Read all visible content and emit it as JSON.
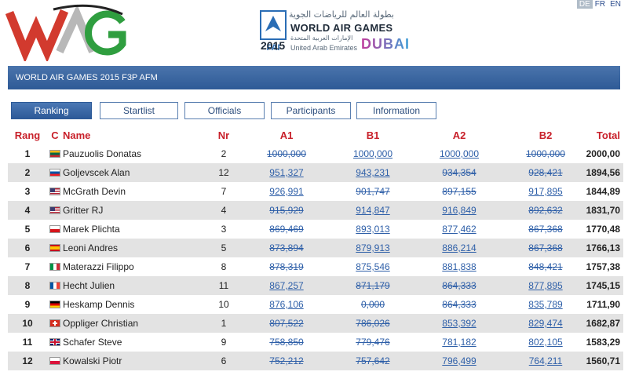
{
  "header": {
    "logo_text": "WAG",
    "fai_text": "FAI",
    "arabic_title": "بطولة العالم للرياضات الجوية",
    "title": "WORLD AIR GAMES",
    "year": "2015",
    "uae_arabic": "الإمارات العربية المتحدة",
    "uae": "United Arab Emirates",
    "dubai": "DUBAI"
  },
  "languages": [
    {
      "label": "DE",
      "active": true
    },
    {
      "label": "FR",
      "active": false
    },
    {
      "label": "EN",
      "active": false
    }
  ],
  "page_title": "WORLD AIR GAMES 2015 F3P AFM",
  "tabs": [
    "Ranking",
    "Startlist",
    "Officials",
    "Participants",
    "Information"
  ],
  "active_tab": "Ranking",
  "columns": {
    "rank": "Rang",
    "country": "C",
    "name": "Name",
    "nr": "Nr",
    "a1": "A1",
    "b1": "B1",
    "a2": "A2",
    "b2": "B2",
    "total": "Total"
  },
  "rows": [
    {
      "rank": "1",
      "flag": "LT",
      "name": "Pauzuolis Donatas",
      "nr": "2",
      "a1": "1000,000",
      "a1_struck": true,
      "b1": "1000,000",
      "b1_struck": false,
      "a2": "1000,000",
      "a2_struck": false,
      "b2": "1000,000",
      "b2_struck": true,
      "total": "2000,00"
    },
    {
      "rank": "2",
      "flag": "SI",
      "name": "Goljevscek Alan",
      "nr": "12",
      "a1": "951,327",
      "a1_struck": false,
      "b1": "943,231",
      "b1_struck": false,
      "a2": "934,354",
      "a2_struck": true,
      "b2": "928,421",
      "b2_struck": true,
      "total": "1894,56"
    },
    {
      "rank": "3",
      "flag": "US",
      "name": "McGrath Devin",
      "nr": "7",
      "a1": "926,991",
      "a1_struck": false,
      "b1": "901,747",
      "b1_struck": true,
      "a2": "897,155",
      "a2_struck": true,
      "b2": "917,895",
      "b2_struck": false,
      "total": "1844,89"
    },
    {
      "rank": "4",
      "flag": "US",
      "name": "Gritter RJ",
      "nr": "4",
      "a1": "915,929",
      "a1_struck": true,
      "b1": "914,847",
      "b1_struck": false,
      "a2": "916,849",
      "a2_struck": false,
      "b2": "892,632",
      "b2_struck": true,
      "total": "1831,70"
    },
    {
      "rank": "5",
      "flag": "CZ",
      "name": "Marek Plichta",
      "nr": "3",
      "a1": "869,469",
      "a1_struck": true,
      "b1": "893,013",
      "b1_struck": false,
      "a2": "877,462",
      "a2_struck": false,
      "b2": "867,368",
      "b2_struck": true,
      "total": "1770,48"
    },
    {
      "rank": "6",
      "flag": "ES",
      "name": "Leoni Andres",
      "nr": "5",
      "a1": "873,894",
      "a1_struck": true,
      "b1": "879,913",
      "b1_struck": false,
      "a2": "886,214",
      "a2_struck": false,
      "b2": "867,368",
      "b2_struck": true,
      "total": "1766,13"
    },
    {
      "rank": "7",
      "flag": "IT",
      "name": "Materazzi Filippo",
      "nr": "8",
      "a1": "878,319",
      "a1_struck": true,
      "b1": "875,546",
      "b1_struck": false,
      "a2": "881,838",
      "a2_struck": false,
      "b2": "848,421",
      "b2_struck": true,
      "total": "1757,38"
    },
    {
      "rank": "8",
      "flag": "FR",
      "name": "Hecht Julien",
      "nr": "11",
      "a1": "867,257",
      "a1_struck": false,
      "b1": "871,179",
      "b1_struck": true,
      "a2": "864,333",
      "a2_struck": true,
      "b2": "877,895",
      "b2_struck": false,
      "total": "1745,15"
    },
    {
      "rank": "9",
      "flag": "DE",
      "name": "Heskamp Dennis",
      "nr": "10",
      "a1": "876,106",
      "a1_struck": false,
      "b1": "0,000",
      "b1_struck": true,
      "a2": "864,333",
      "a2_struck": true,
      "b2": "835,789",
      "b2_struck": false,
      "total": "1711,90"
    },
    {
      "rank": "10",
      "flag": "CH",
      "name": "Oppliger Christian",
      "nr": "1",
      "a1": "807,522",
      "a1_struck": true,
      "b1": "786,026",
      "b1_struck": true,
      "a2": "853,392",
      "a2_struck": false,
      "b2": "829,474",
      "b2_struck": false,
      "total": "1682,87"
    },
    {
      "rank": "11",
      "flag": "GB",
      "name": "Schafer Steve",
      "nr": "9",
      "a1": "758,850",
      "a1_struck": true,
      "b1": "779,476",
      "b1_struck": true,
      "a2": "781,182",
      "a2_struck": false,
      "b2": "802,105",
      "b2_struck": false,
      "total": "1583,29"
    },
    {
      "rank": "12",
      "flag": "PL",
      "name": "Kowalski Piotr",
      "nr": "6",
      "a1": "752,212",
      "a1_struck": true,
      "b1": "757,642",
      "b1_struck": true,
      "a2": "796,499",
      "a2_struck": false,
      "b2": "764,211",
      "b2_struck": false,
      "total": "1560,71"
    }
  ],
  "colors": {
    "header_red": "#c8202a",
    "link_blue": "#2e5fa8",
    "title_bar": "#3a66a2",
    "row_alt": "#e3e3e3"
  }
}
